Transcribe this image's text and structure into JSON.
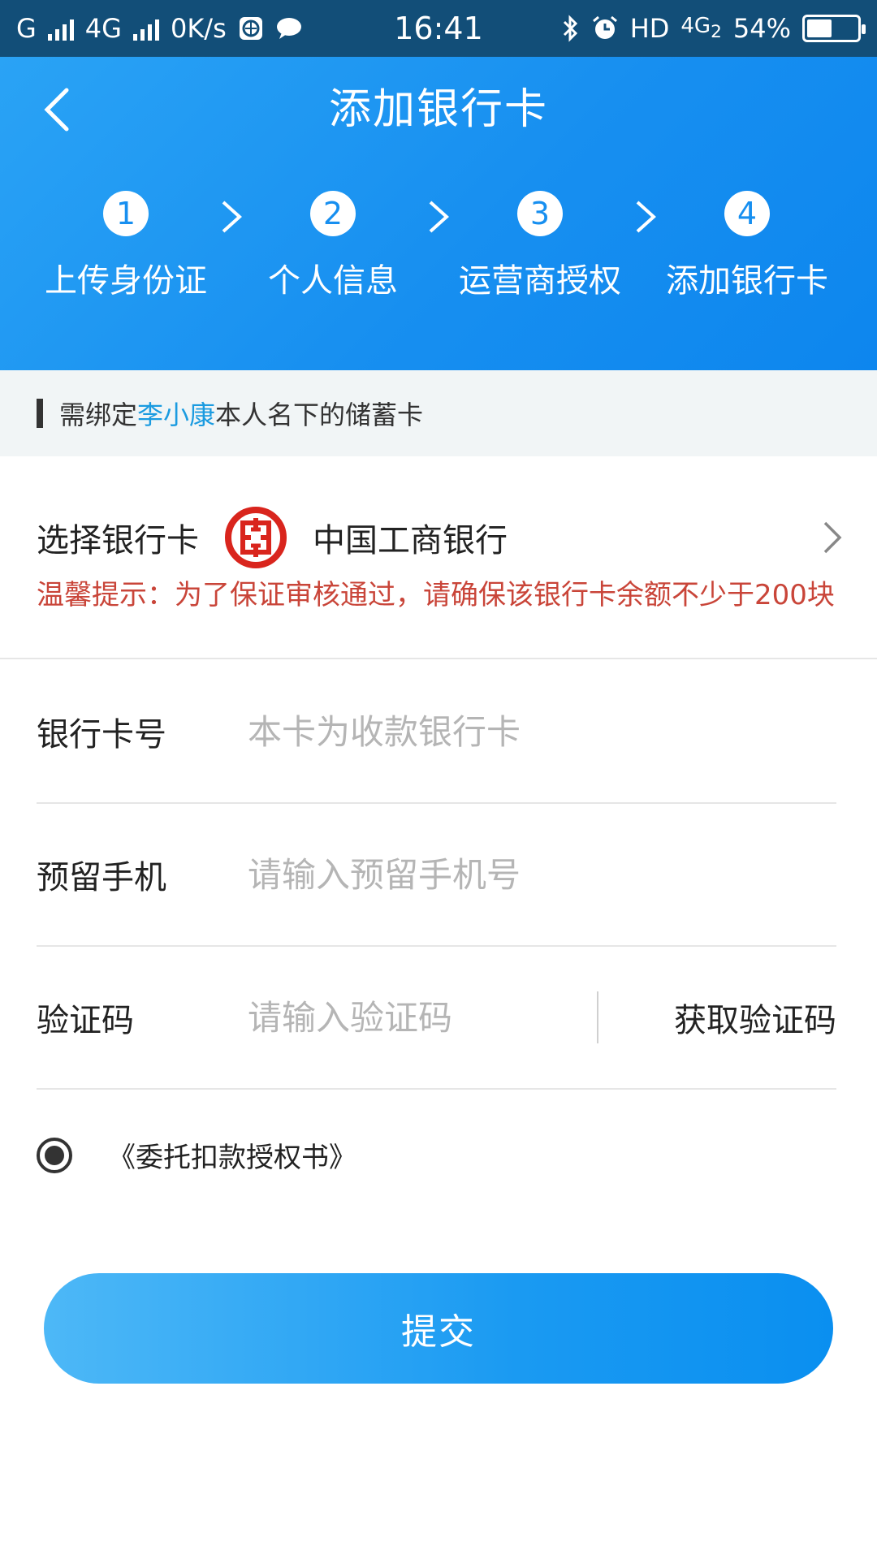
{
  "status_bar": {
    "carrier1": "G",
    "carrier2": "4G",
    "speed": "0K/s",
    "time": "16:41",
    "hd": "HD",
    "network": "4G",
    "network_sub": "2",
    "battery": "54%",
    "battery_level": 0.54
  },
  "header": {
    "title": "添加银行卡",
    "steps": [
      {
        "num": "1",
        "label": "上传身份证"
      },
      {
        "num": "2",
        "label": "个人信息"
      },
      {
        "num": "3",
        "label": "运营商授权"
      },
      {
        "num": "4",
        "label": "添加银行卡"
      }
    ]
  },
  "notice": {
    "prefix": "需绑定",
    "name": "李小康",
    "suffix": "本人名下的储蓄卡"
  },
  "bank_select": {
    "label": "选择银行卡",
    "bank_name": "中国工商银行",
    "tip": "温馨提示：为了保证审核通过，请确保该银行卡余额不少于200块"
  },
  "form": {
    "card_number": {
      "label": "银行卡号",
      "placeholder": "本卡为收款银行卡",
      "value": ""
    },
    "phone": {
      "label": "预留手机",
      "placeholder": "请输入预留手机号",
      "value": ""
    },
    "code": {
      "label": "验证码",
      "placeholder": "请输入验证码",
      "value": "",
      "button": "获取验证码"
    }
  },
  "agreement": {
    "text": "《委托扣款授权书》",
    "checked": true
  },
  "submit": {
    "label": "提交"
  },
  "colors": {
    "status_bar_bg": "#124e78",
    "header_blue": "#178ff0",
    "accent_name": "#1b9be0",
    "tip_red": "#c94539",
    "bank_logo_red": "#d9251d"
  }
}
